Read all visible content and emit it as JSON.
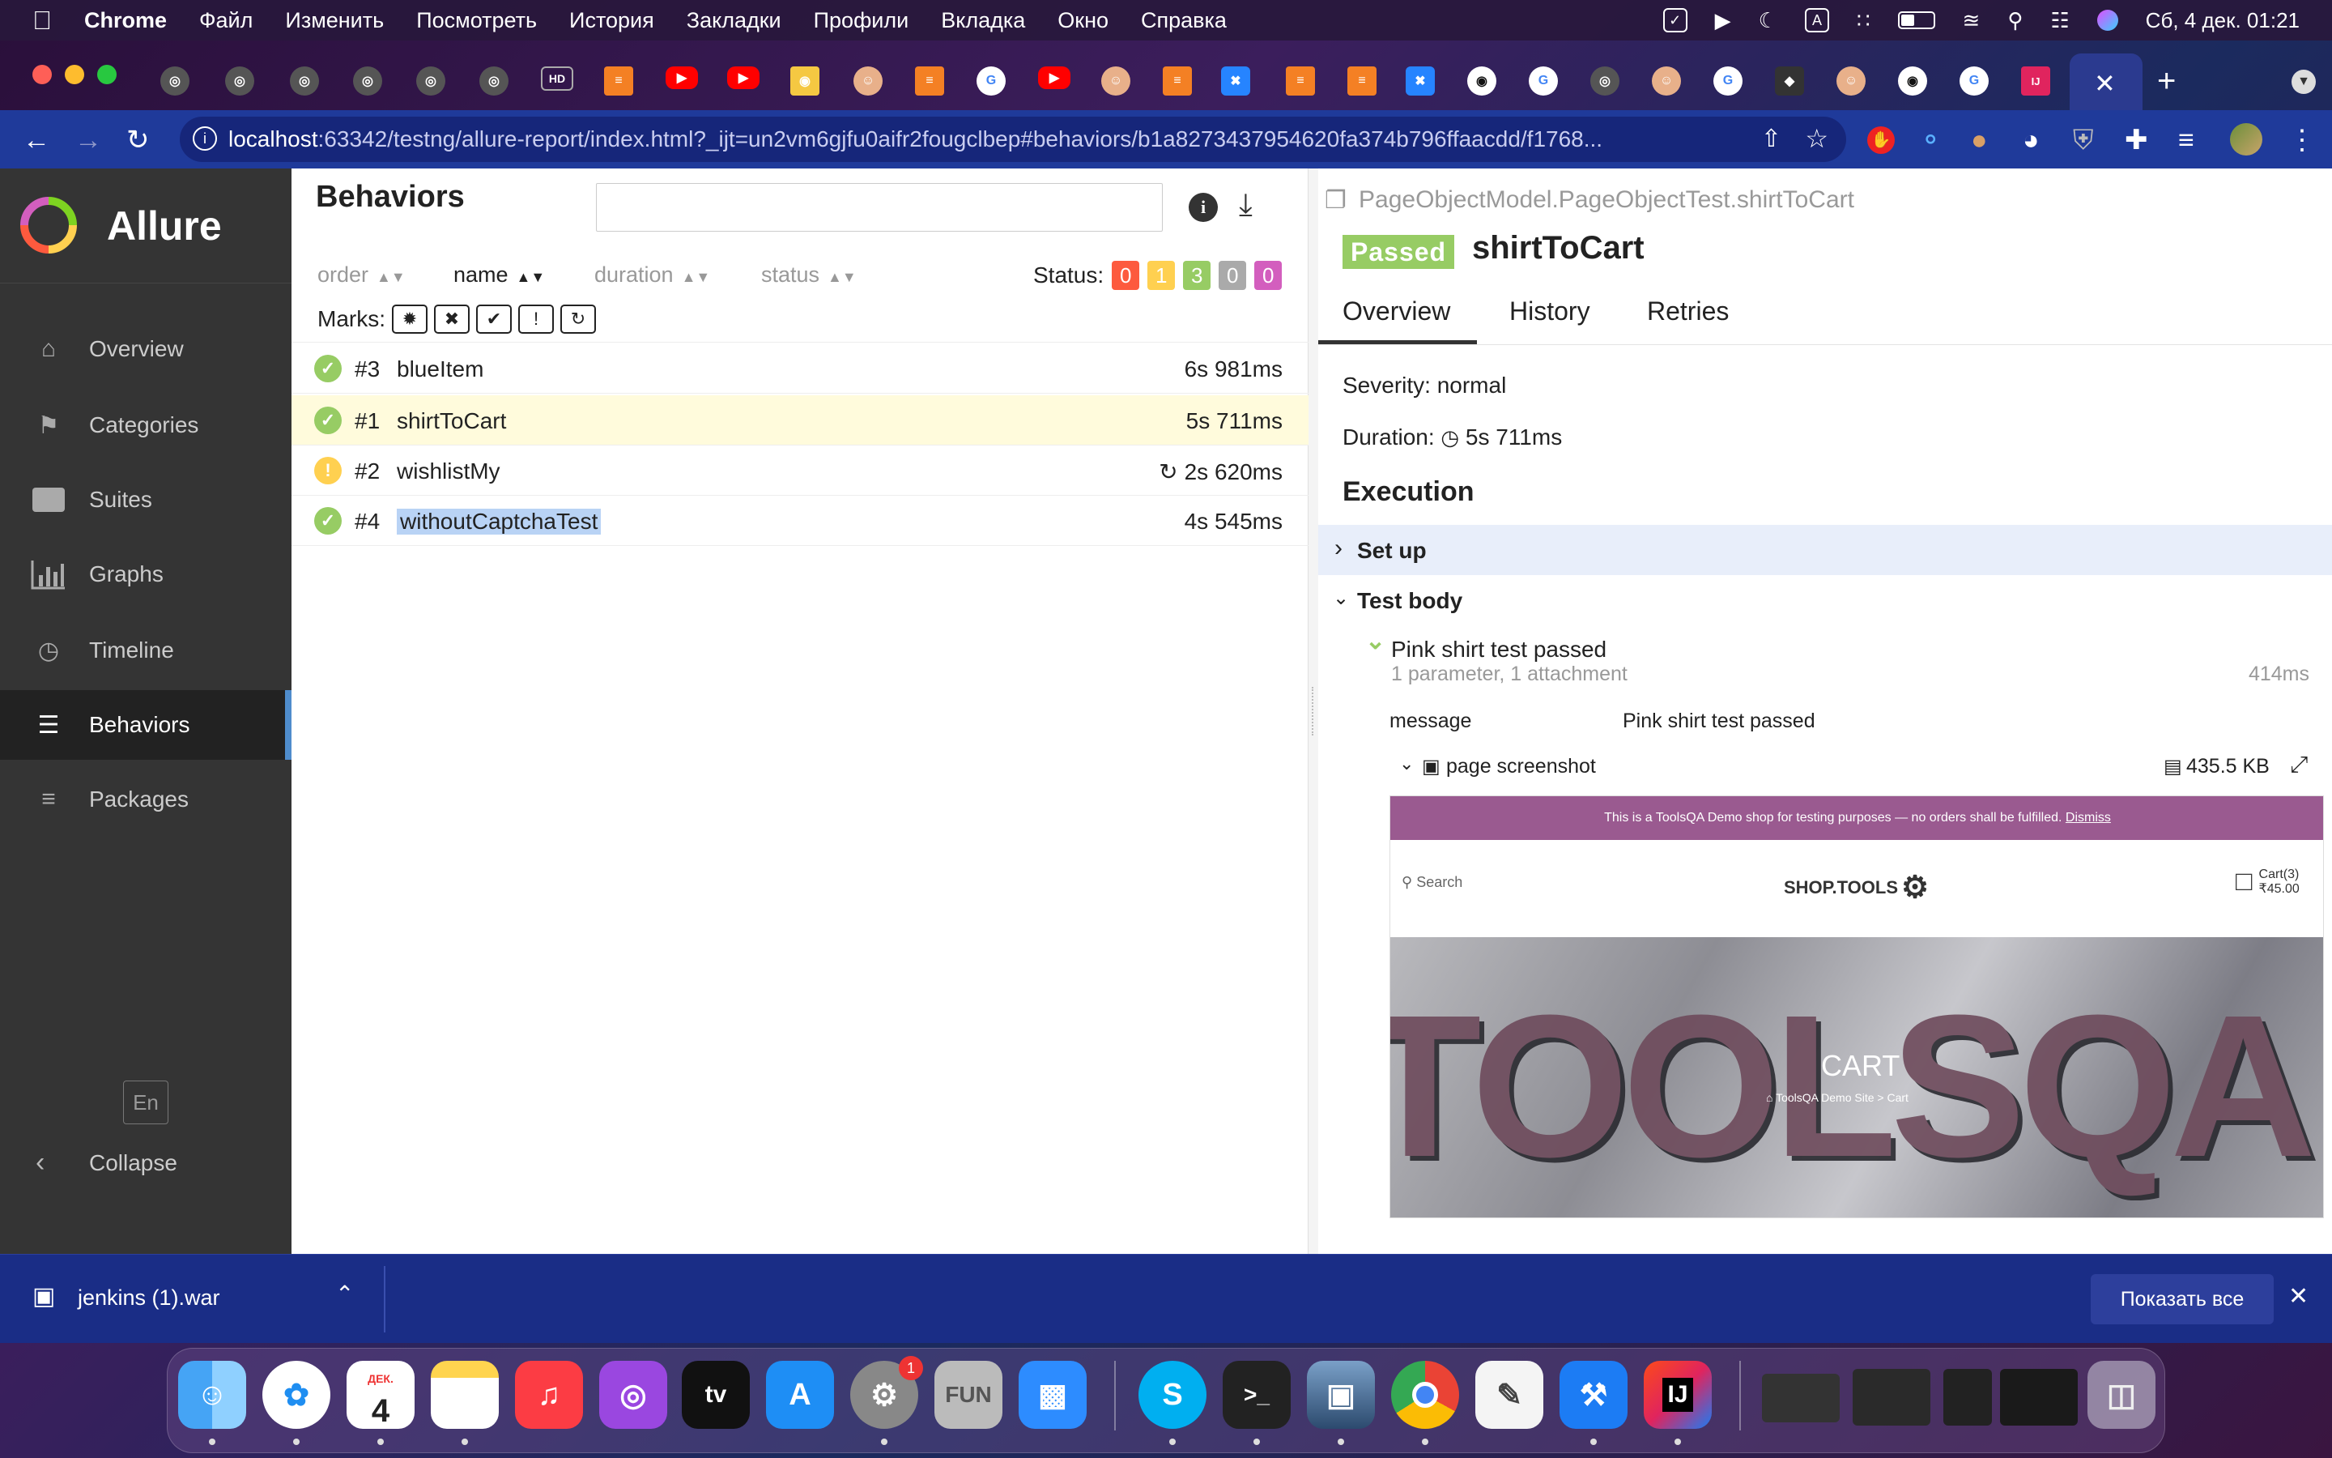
{
  "menubar": {
    "app": "Chrome",
    "items": [
      "Файл",
      "Изменить",
      "Посмотреть",
      "История",
      "Закладки",
      "Профили",
      "Вкладка",
      "Окно",
      "Справка"
    ],
    "clock": "Сб, 4 дек.  01:21",
    "input_source": "A"
  },
  "tabs": {
    "hd_label": "HD",
    "ij_label": "IJ"
  },
  "address": {
    "host": "localhost",
    "rest": ":63342/testng/allure-report/index.html?_ijt=un2vm6gjfu0aifr2fougclbep#behaviors/b1a8273437954620fa374b796ffaacdd/f1768..."
  },
  "sidebar": {
    "brand": "Allure",
    "items": [
      {
        "label": "Overview",
        "icon": "home-icon"
      },
      {
        "label": "Categories",
        "icon": "flag-icon"
      },
      {
        "label": "Suites",
        "icon": "briefcase-icon"
      },
      {
        "label": "Graphs",
        "icon": "bar-chart-icon"
      },
      {
        "label": "Timeline",
        "icon": "clock-icon"
      },
      {
        "label": "Behaviors",
        "icon": "list-icon"
      },
      {
        "label": "Packages",
        "icon": "align-left-icon"
      }
    ],
    "lang": "En",
    "collapse": "Collapse"
  },
  "behaviors": {
    "title": "Behaviors",
    "search_placeholder": "",
    "sort": {
      "order": "order",
      "name": "name",
      "duration": "duration",
      "status": "status"
    },
    "status_label": "Status:",
    "status_counts": [
      {
        "value": "0",
        "color": "#fd5a3e"
      },
      {
        "value": "1",
        "color": "#ffd050"
      },
      {
        "value": "3",
        "color": "#97cc64"
      },
      {
        "value": "0",
        "color": "#aaaaaa"
      },
      {
        "value": "0",
        "color": "#d35ebe"
      }
    ],
    "marks_label": "Marks:",
    "rows": [
      {
        "num": "#3",
        "name": "blueItem",
        "duration": "6s 981ms",
        "status": "passed"
      },
      {
        "num": "#1",
        "name": "shirtToCart",
        "duration": "5s 711ms",
        "status": "passed"
      },
      {
        "num": "#2",
        "name": "wishlistMy",
        "duration": "2s 620ms",
        "status": "broken"
      },
      {
        "num": "#4",
        "name": "withoutCaptchaTest",
        "duration": "4s 545ms",
        "status": "passed"
      }
    ]
  },
  "detail": {
    "path": "PageObjectModel.PageObjectTest.shirtToCart",
    "status": "Passed",
    "name": "shirtToCart",
    "tabs": [
      "Overview",
      "History",
      "Retries"
    ],
    "severity": "Severity: normal",
    "duration_label": "Duration:",
    "duration": "5s 711ms",
    "execution": "Execution",
    "setup": "Set up",
    "test_body": "Test body",
    "step_name": "Pink shirt test passed",
    "step_meta": "1 parameter, 1 attachment",
    "step_duration": "414ms",
    "param_name": "message",
    "param_value": "Pink shirt test passed",
    "attachment": "page screenshot",
    "attachment_size": "435.5 KB"
  },
  "screenshot": {
    "banner": "This is a ToolsQA Demo shop for testing purposes — no orders shall be fulfilled.",
    "dismiss": "Dismiss",
    "search": "Search",
    "brand": "SHOP.TOOLS",
    "cart": "Cart(3)",
    "cart_total": "₹45.00",
    "hero_title": "CART",
    "crumb_home": "ToolsQA Demo Site",
    "crumb_sep": ">",
    "crumb_current": "Cart",
    "bg_text": "TOOLSQA"
  },
  "downloads": {
    "file": "jenkins (1).war",
    "show_all": "Показать все"
  },
  "dock": {
    "calendar_month": "ДЕК.",
    "calendar_day": "4",
    "settings_badge": "1",
    "fun_label": "FUN",
    "tv_label": "tv",
    "terminal_label": ">_",
    "ij_label": "IJ"
  }
}
